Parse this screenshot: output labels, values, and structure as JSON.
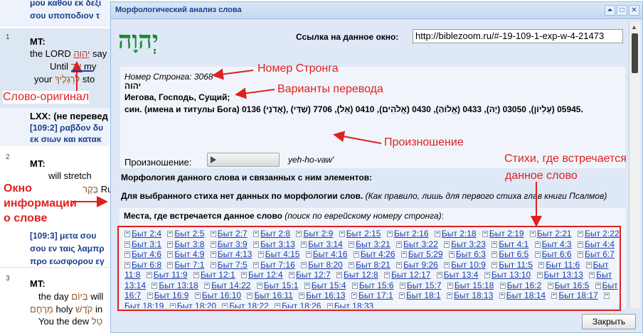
{
  "background": {
    "top": {
      "line1": "μου καθου εκ δεξι",
      "line2": "σου υποποδιον τ"
    },
    "v1": {
      "num": "1",
      "mt": "MT:",
      "en1": "the LORD",
      "heb1": "יְהוָה",
      "en1b": "say",
      "en2": "Until",
      "heb2": "עַד",
      "en2b": "my",
      "en3": "your",
      "heb3": "לְרַגְלֶיךָ",
      "en3b": "sto",
      "lxx": "LXX: (не перевед",
      "gr1": "[109:2] ραβδον δυ",
      "gr2": "εκ σιων και κατακ"
    },
    "v2": {
      "num": "2",
      "mt": "MT:",
      "en1": "will stretch",
      "heb1": "בְּקֶר",
      "heb1b": "Ru",
      "gr1": "[109:3] μετα σου",
      "gr2": "σου εν ταις λαμπρ",
      "gr3": "προ εωσφορου εγ"
    },
    "v3": {
      "num": "3",
      "mt": "MT:",
      "en1": "the day",
      "heb1": "בְּיוֹם",
      "en1b": "will",
      "heb2": "מֵרֶחֶם",
      "en2": "holy",
      "heb2b": "קֹדֶשׁ",
      "en2b": "in",
      "en3": "You the dew",
      "heb3": "טַל"
    }
  },
  "dialog": {
    "title": "Морфологический анализ слова",
    "buttons": {
      "collapse": "⏶",
      "maximize": "□",
      "close": "✕"
    },
    "hebrew_word": "יְהוָה",
    "link_label": "Ссылка на данное окно:",
    "link_value": "http://biblezoom.ru/#-19-109-1-exp-w-4-21473",
    "strong_number": "Номер Стронга: 3068",
    "word": "יהוה",
    "translation_variants": "Иегова, Господь, Сущий;",
    "synonyms": "син. (имена и титулы Бога) 0136 (אֲדֹנָי), 05945 (עֶלְיוֹן), 03050 (יָהּ), 0433 (אֱלוֹהַּ), 0430 (אֱלֹהִים), 0410 (אֵל), 7706 (שַׁדַּי).",
    "pronunciation_label": "Произношение:",
    "pronunciation": "yeh-ho-vaw'",
    "morph_title": "Морфология данного слова и связанных с ним элементов:",
    "morph_note": "Для выбранного стиха нет данных по морфологии слов.",
    "morph_hint": "(Как правило, лишь для первого стиха глав книги Псалмов)",
    "places_title": "Места, где встречается данное слово",
    "places_hint": "(поиск по еврейскому номеру стронга)",
    "verses": [
      "Быт 2:4",
      "Быт 2:5",
      "Быт 2:7",
      "Быт 2:8",
      "Быт 2:9",
      "Быт 2:15",
      "Быт 2:16",
      "Быт 2:18",
      "Быт 2:19",
      "Быт 2:21",
      "Быт 2:22",
      "Быт 3:1",
      "Быт 3:8",
      "Быт 3:9",
      "Быт 3:13",
      "Быт 3:14",
      "Быт 3:21",
      "Быт 3:22",
      "Быт 3:23",
      "Быт 4:1",
      "Быт 4:3",
      "Быт 4:4",
      "Быт 4:6",
      "Быт 4:9",
      "Быт 4:13",
      "Быт 4:15",
      "Быт 4:16",
      "Быт 4:26",
      "Быт 5:29",
      "Быт 6:3",
      "Быт 6:5",
      "Быт 6:6",
      "Быт 6:7",
      "Быт 6:8",
      "Быт 7:1",
      "Быт 7:5",
      "Быт 7:16",
      "Быт 8:20",
      "Быт 8:21",
      "Быт 9:26",
      "Быт 10:9",
      "Быт 11:5",
      "Быт 11:6",
      "Быт 11:8",
      "Быт 11:9",
      "Быт 12:1",
      "Быт 12:4",
      "Быт 12:7",
      "Быт 12:8",
      "Быт 12:17",
      "Быт 13:4",
      "Быт 13:10",
      "Быт 13:13",
      "Быт 13:14",
      "Быт 13:18",
      "Быт 14:22",
      "Быт 15:1",
      "Быт 15:4",
      "Быт 15:6",
      "Быт 15:7",
      "Быт 15:18",
      "Быт 16:2",
      "Быт 16:5",
      "Быт 16:7",
      "Быт 16:9",
      "Быт 16:10",
      "Быт 16:11",
      "Быт 16:13",
      "Быт 17:1",
      "Быт 18:1",
      "Быт 18:13",
      "Быт 18:14",
      "Быт 18:17",
      "Быт 18:19",
      "Быт 18:20",
      "Быт 18:22",
      "Быт 18:26",
      "Быт 18:33"
    ],
    "close_button": "Закрыть"
  },
  "annotations": {
    "original_word": "Слово-оригинал",
    "window_info": [
      "Окно",
      "информации",
      "о слове"
    ],
    "strong_number": "Номер Стронга",
    "translation_variants": "Варианты перевода",
    "pronunciation": "Произношение",
    "verses_where": [
      "Стихи, где встречается",
      "данное слово"
    ],
    "color": "#e02020"
  }
}
